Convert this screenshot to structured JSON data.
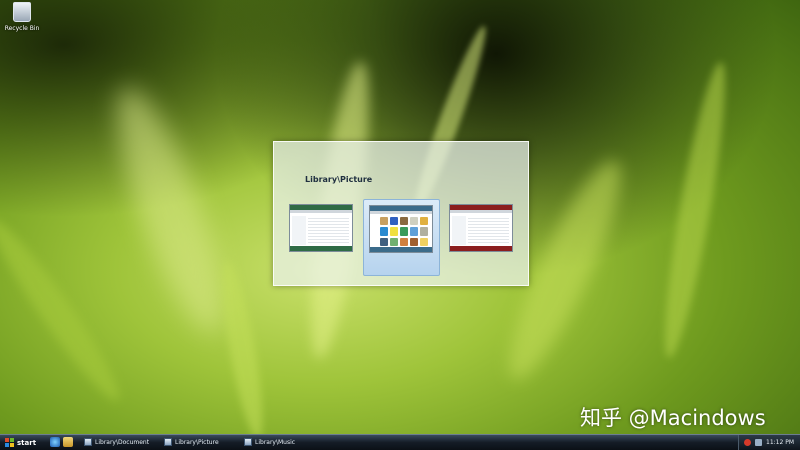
{
  "desktop": {
    "icons": [
      {
        "label": "Recycle Bin",
        "icon": "recycle-bin-icon"
      }
    ]
  },
  "switcher": {
    "title": "Library\\Picture",
    "windows": [
      {
        "name": "Library\\Document",
        "accent": "#2f6b45",
        "selected": false
      },
      {
        "name": "Library\\Picture",
        "accent": "#3b6b8a",
        "selected": true
      },
      {
        "name": "Library\\Music",
        "accent": "#8b1e1e",
        "selected": false
      }
    ]
  },
  "taskbar": {
    "start_label": "start",
    "quick_launch": [
      "internet-explorer-icon",
      "folder-icon"
    ],
    "buttons": [
      {
        "label": "Library\\Document"
      },
      {
        "label": "Library\\Picture"
      },
      {
        "label": "Library\\Music"
      }
    ],
    "tray_icons": [
      "security-shield-icon",
      "network-icon"
    ],
    "clock": "11:12 PM"
  },
  "watermark": "知乎 @Macindows"
}
